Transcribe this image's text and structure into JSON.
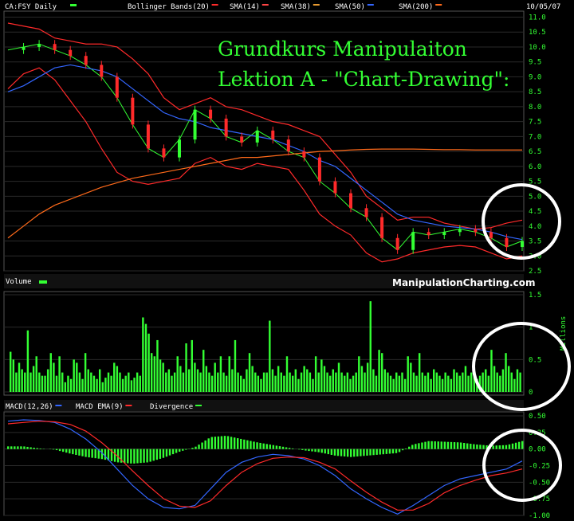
{
  "header": {
    "symbol_label": "CA:FSY Daily",
    "date": "10/05/07",
    "overlays": [
      {
        "label": "Bollinger Bands(20)",
        "color": "#ff2a2a"
      },
      {
        "label": "SMA(14)",
        "color": "#ff4444"
      },
      {
        "label": "SMA(38)",
        "color": "#e89a30"
      },
      {
        "label": "SMA(50)",
        "color": "#3366ff"
      },
      {
        "label": "SMA(200)",
        "color": "#ff6a1a"
      }
    ]
  },
  "annotation": {
    "line1": "Grundkurs Manipulaiton",
    "line2": "Lektion A - \"Chart-Drawing\":"
  },
  "watermark": "ManipulationCharting.com",
  "volume_panel": {
    "label": "Volume",
    "unit": "Millions",
    "ticks": [
      "1.5",
      "1",
      "0.5",
      "0"
    ]
  },
  "macd_panel": {
    "labels": [
      "MACD(12,26)",
      "MACD EMA(9)",
      "Divergence"
    ],
    "label_colors": [
      "#3366ff",
      "#ff2a2a",
      "#33ff33"
    ],
    "ticks": [
      "0.50",
      "0.25",
      "0.00",
      "-0.25",
      "-0.50",
      "-0.75",
      "-1.00"
    ]
  },
  "chart_data": [
    {
      "type": "line",
      "panel": "price",
      "y_ticks": [
        "11.0",
        "10.5",
        "10.0",
        "9.5",
        "9.0",
        "8.5",
        "8.0",
        "7.5",
        "7.0",
        "6.5",
        "6.0",
        "5.5",
        "5.0",
        "4.5",
        "4.0",
        "3.5",
        "3.0",
        "2.5"
      ],
      "ylim": [
        2.5,
        11.2
      ],
      "x": [
        0,
        10,
        20,
        30,
        40,
        50,
        60,
        70,
        80,
        90,
        100,
        110,
        120,
        130,
        140,
        150,
        160,
        170,
        180,
        190,
        200,
        210,
        220,
        230,
        240,
        250,
        260,
        270,
        280,
        290,
        300,
        310,
        320,
        330
      ],
      "series": [
        {
          "name": "Close",
          "color": "#33ff33",
          "values": [
            9.9,
            10.0,
            10.1,
            9.9,
            9.7,
            9.4,
            9.0,
            8.3,
            7.4,
            6.6,
            6.3,
            6.9,
            7.9,
            7.6,
            7.0,
            6.8,
            7.2,
            6.9,
            6.5,
            6.3,
            5.5,
            5.1,
            4.6,
            4.3,
            3.6,
            3.2,
            3.8,
            3.7,
            3.8,
            3.9,
            3.8,
            3.6,
            3.3,
            3.5
          ]
        },
        {
          "name": "Bollinger Bands(20)",
          "color": "#ff2a2a",
          "values": [
            10.8,
            10.7,
            10.6,
            10.3,
            10.2,
            10.1,
            10.1,
            10.0,
            9.6,
            9.1,
            8.3,
            7.9,
            8.1,
            8.3,
            8.0,
            7.9,
            7.7,
            7.5,
            7.4,
            7.2,
            7.0,
            6.4,
            5.8,
            5.0,
            4.6,
            4.2,
            4.3,
            4.3,
            4.1,
            4.0,
            3.9,
            3.95,
            4.1,
            4.2
          ]
        },
        {
          "name": "Bollinger Bands(20)",
          "color": "#ff2a2a",
          "values": [
            8.6,
            9.1,
            9.3,
            8.9,
            8.2,
            7.5,
            6.6,
            5.8,
            5.5,
            5.4,
            5.5,
            5.6,
            6.1,
            6.3,
            6.0,
            5.9,
            6.1,
            6.0,
            5.9,
            5.2,
            4.4,
            4.0,
            3.7,
            3.1,
            2.8,
            2.9,
            3.1,
            3.2,
            3.3,
            3.35,
            3.3,
            3.1,
            2.9,
            3.0
          ]
        },
        {
          "name": "SMA(50)",
          "color": "#3366ff",
          "values": [
            8.5,
            8.7,
            9.0,
            9.3,
            9.4,
            9.3,
            9.2,
            9.0,
            8.6,
            8.2,
            7.8,
            7.6,
            7.5,
            7.3,
            7.2,
            7.1,
            7.0,
            6.9,
            6.7,
            6.5,
            6.2,
            6.0,
            5.6,
            5.2,
            4.8,
            4.4,
            4.2,
            4.1,
            4.0,
            3.95,
            3.9,
            3.8,
            3.65,
            3.55
          ]
        },
        {
          "name": "SMA(200)",
          "color": "#ff6a1a",
          "values": [
            3.6,
            4.0,
            4.4,
            4.7,
            4.9,
            5.1,
            5.3,
            5.45,
            5.6,
            5.7,
            5.8,
            5.9,
            6.0,
            6.1,
            6.2,
            6.3,
            6.3,
            6.35,
            6.4,
            6.45,
            6.5,
            6.52,
            6.55,
            6.57,
            6.58,
            6.58,
            6.58,
            6.57,
            6.56,
            6.56,
            6.55,
            6.55,
            6.55,
            6.55
          ]
        }
      ]
    },
    {
      "type": "bar",
      "panel": "volume",
      "ylabel": "Millions",
      "ylim": [
        0,
        1.5
      ],
      "values": [
        0.62,
        0.5,
        0.3,
        0.45,
        0.35,
        0.3,
        0.95,
        0.3,
        0.4,
        0.55,
        0.3,
        0.25,
        0.25,
        0.35,
        0.6,
        0.45,
        0.25,
        0.55,
        0.3,
        0.15,
        0.25,
        0.2,
        0.5,
        0.45,
        0.3,
        0.2,
        0.6,
        0.35,
        0.3,
        0.25,
        0.2,
        0.35,
        0.15,
        0.22,
        0.3,
        0.25,
        0.45,
        0.4,
        0.3,
        0.2,
        0.25,
        0.3,
        0.18,
        0.22,
        0.3,
        0.25,
        1.15,
        1.05,
        0.9,
        0.6,
        0.55,
        0.8,
        0.5,
        0.45,
        0.3,
        0.35,
        0.25,
        0.3,
        0.55,
        0.4,
        0.3,
        0.75,
        0.35,
        0.8,
        0.45,
        0.35,
        0.3,
        0.65,
        0.4,
        0.3,
        0.25,
        0.45,
        0.3,
        0.55,
        0.3,
        0.25,
        0.55,
        0.35,
        0.8,
        0.3,
        0.25,
        0.2,
        0.35,
        0.6,
        0.4,
        0.3,
        0.25,
        0.2,
        0.3,
        0.3,
        1.1,
        0.35,
        0.25,
        0.4,
        0.3,
        0.25,
        0.55,
        0.3,
        0.25,
        0.35,
        0.2,
        0.3,
        0.4,
        0.35,
        0.3,
        0.2,
        0.55,
        0.3,
        0.5,
        0.4,
        0.3,
        0.25,
        0.35,
        0.3,
        0.45,
        0.3,
        0.25,
        0.3,
        0.2,
        0.25,
        0.3,
        0.55,
        0.4,
        0.3,
        0.45,
        1.4,
        0.35,
        0.25,
        0.65,
        0.6,
        0.35,
        0.3,
        0.25,
        0.2,
        0.3,
        0.25,
        0.3,
        0.2,
        0.55,
        0.45,
        0.3,
        0.25,
        0.6,
        0.3,
        0.25,
        0.3,
        0.2,
        0.35,
        0.3,
        0.25,
        0.2,
        0.3,
        0.25,
        0.2,
        0.35,
        0.3,
        0.25,
        0.3,
        0.4,
        0.25,
        0.3,
        0.35,
        0.2,
        0.25,
        0.3,
        0.35,
        0.25,
        0.65,
        0.4,
        0.3,
        0.25,
        0.35,
        0.6,
        0.4,
        0.3,
        0.2,
        0.35,
        0.3
      ]
    },
    {
      "type": "line",
      "panel": "macd",
      "ylim": [
        -1.0,
        0.5
      ],
      "x": [
        0,
        10,
        20,
        30,
        40,
        50,
        60,
        70,
        80,
        90,
        100,
        110,
        120,
        130,
        140,
        150,
        160,
        170,
        180,
        190,
        200,
        210,
        220,
        230,
        240,
        250,
        260,
        270,
        280,
        290,
        300,
        310,
        320,
        330
      ],
      "series": [
        {
          "name": "MACD(12,26)",
          "color": "#3366ff",
          "values": [
            0.42,
            0.44,
            0.43,
            0.4,
            0.3,
            0.15,
            -0.05,
            -0.3,
            -0.55,
            -0.75,
            -0.88,
            -0.9,
            -0.85,
            -0.6,
            -0.35,
            -0.2,
            -0.12,
            -0.08,
            -0.1,
            -0.15,
            -0.25,
            -0.4,
            -0.6,
            -0.75,
            -0.88,
            -0.98,
            -0.85,
            -0.7,
            -0.55,
            -0.45,
            -0.4,
            -0.35,
            -0.3,
            -0.18
          ]
        },
        {
          "name": "MACD EMA(9)",
          "color": "#ff2a2a",
          "values": [
            0.38,
            0.4,
            0.42,
            0.41,
            0.37,
            0.27,
            0.1,
            -0.1,
            -0.33,
            -0.55,
            -0.75,
            -0.86,
            -0.88,
            -0.78,
            -0.55,
            -0.35,
            -0.22,
            -0.14,
            -0.12,
            -0.13,
            -0.2,
            -0.3,
            -0.48,
            -0.65,
            -0.8,
            -0.92,
            -0.92,
            -0.82,
            -0.66,
            -0.55,
            -0.47,
            -0.4,
            -0.36,
            -0.3
          ]
        }
      ],
      "divergence": [
        0.04,
        0.04,
        0.01,
        -0.01,
        -0.07,
        -0.12,
        -0.15,
        -0.2,
        -0.22,
        -0.2,
        -0.13,
        -0.04,
        0.03,
        0.18,
        0.2,
        0.15,
        0.1,
        0.06,
        0.02,
        -0.02,
        -0.05,
        -0.1,
        -0.12,
        -0.1,
        -0.08,
        -0.06,
        0.07,
        0.12,
        0.11,
        0.1,
        0.07,
        0.05,
        0.06,
        0.12
      ]
    }
  ]
}
